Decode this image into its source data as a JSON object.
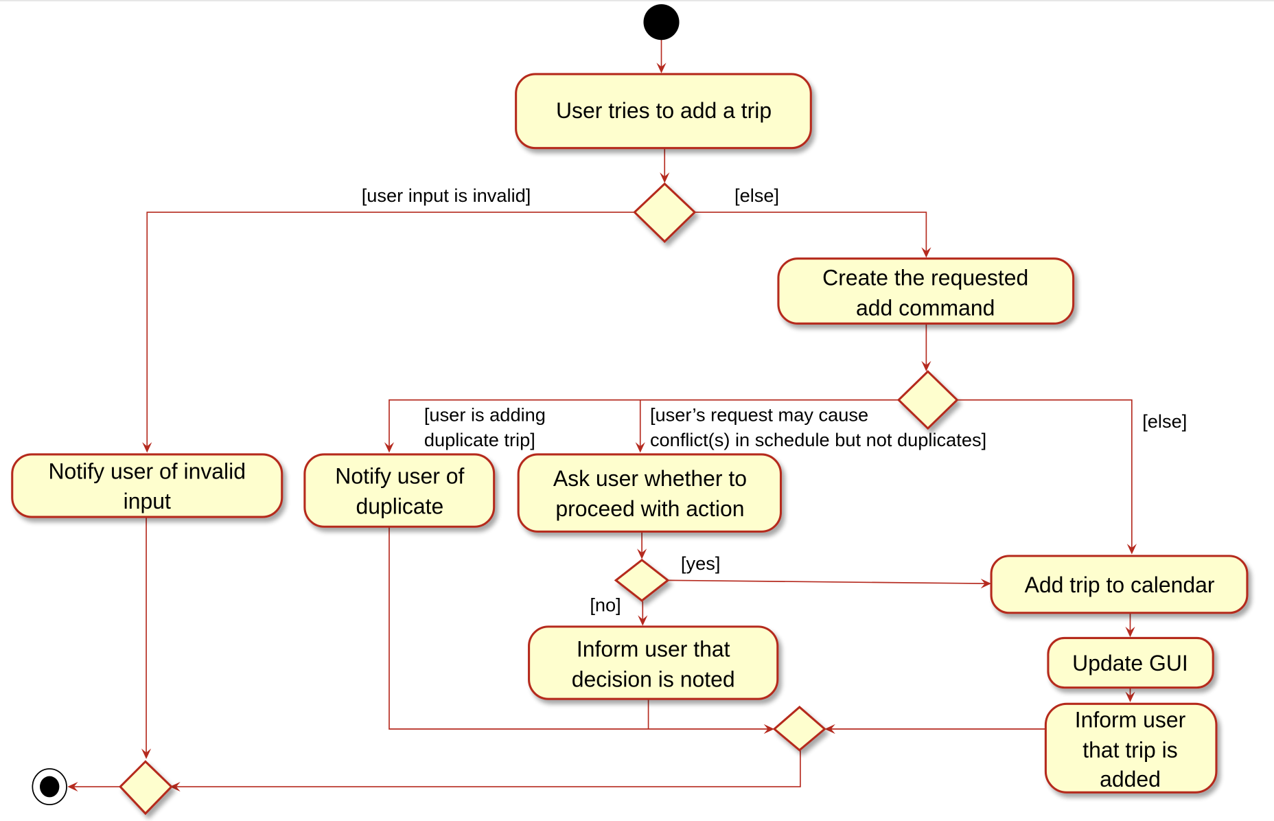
{
  "diagram": {
    "type": "UML activity diagram",
    "colors": {
      "node_fill": "#fefece",
      "border": "#b52a1f",
      "text": "#000000",
      "start": "#000000"
    },
    "start_node": "start",
    "end_node": "end",
    "activities": {
      "add_trip_attempt": [
        "User tries to add a trip"
      ],
      "notify_invalid": [
        "Notify user of invalid",
        "input"
      ],
      "create_command": [
        "Create the requested",
        "add command"
      ],
      "notify_duplicate": [
        "Notify user of",
        "duplicate"
      ],
      "ask_proceed": [
        "Ask user whether to",
        "proceed with action"
      ],
      "inform_noted": [
        "Inform user that",
        "decision is noted"
      ],
      "add_to_calendar": [
        "Add trip to calendar"
      ],
      "update_gui": [
        "Update GUI"
      ],
      "inform_added": [
        "Inform user",
        "that trip is",
        "added"
      ]
    },
    "guards": {
      "invalid_input": "[user input is invalid]",
      "else_1": "[else]",
      "duplicate": [
        "[user is adding",
        "duplicate trip]"
      ],
      "conflict": [
        "[user’s request may cause",
        "conflict(s) in schedule but not duplicates]"
      ],
      "else_2": "[else]",
      "yes": "[yes]",
      "no": "[no]"
    },
    "edges": [
      {
        "from": "start",
        "to": "add_trip_attempt"
      },
      {
        "from": "add_trip_attempt",
        "to": "decision_validity"
      },
      {
        "from": "decision_validity",
        "to": "notify_invalid",
        "guard": "[user input is invalid]"
      },
      {
        "from": "decision_validity",
        "to": "create_command",
        "guard": "[else]"
      },
      {
        "from": "create_command",
        "to": "decision_type"
      },
      {
        "from": "decision_type",
        "to": "notify_duplicate",
        "guard": "[user is adding duplicate trip]"
      },
      {
        "from": "decision_type",
        "to": "ask_proceed",
        "guard": "[user’s request may cause conflict(s) in schedule but not duplicates]"
      },
      {
        "from": "decision_type",
        "to": "add_to_calendar",
        "guard": "[else]"
      },
      {
        "from": "ask_proceed",
        "to": "decision_proceed"
      },
      {
        "from": "decision_proceed",
        "to": "add_to_calendar",
        "guard": "[yes]"
      },
      {
        "from": "decision_proceed",
        "to": "inform_noted",
        "guard": "[no]"
      },
      {
        "from": "add_to_calendar",
        "to": "update_gui"
      },
      {
        "from": "update_gui",
        "to": "inform_added"
      },
      {
        "from": "notify_duplicate",
        "to": "merge_inner"
      },
      {
        "from": "inform_noted",
        "to": "merge_inner"
      },
      {
        "from": "inform_added",
        "to": "merge_inner"
      },
      {
        "from": "notify_invalid",
        "to": "merge_final"
      },
      {
        "from": "merge_inner",
        "to": "merge_final"
      },
      {
        "from": "merge_final",
        "to": "end"
      }
    ]
  }
}
